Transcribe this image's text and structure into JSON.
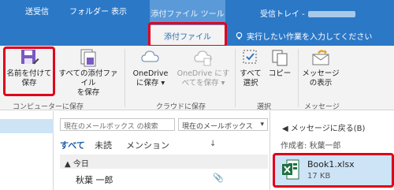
{
  "titlebar": {
    "context_tools": "添付ファイル ツール",
    "window_title": "受信トレイ -"
  },
  "ribbon_tabs": {
    "receive": "送受信",
    "folder": "フォルダー",
    "view": "表示",
    "attachment": "添付ファイル",
    "tell_me": "実行したい作業を入力してください"
  },
  "ribbon": {
    "save_as": "名前を付けて\n保存",
    "save_all": "すべての添付ファイル\nを保存",
    "onedrive_save": "OneDrive\nに保存 ▾",
    "onedrive_all": "OneDrive にす\nべてを保存 ▾",
    "select_all": "すべて\n選択",
    "copy": "コピー",
    "show_message": "メッセージ\nの表示",
    "group_save": "コンピューターに保存",
    "group_cloud": "クラウドに保存",
    "group_select": "選択",
    "group_message": "メッセージ"
  },
  "list": {
    "search_placeholder": "現在のメールボックス の検索",
    "scope": "現在のメールボックス",
    "filter_all": "すべて",
    "filter_unread": "未読",
    "filter_mention": "メンション",
    "sort_arrow": "↓",
    "today": "▲ 今日",
    "sender": "秋葉 一郎"
  },
  "reading": {
    "back": "メッセージに戻る(B)",
    "from_label": "作成者:",
    "from_name": "秋葉一郎",
    "attachment_name": "Book1.xlsx",
    "attachment_size": "17 KB"
  },
  "colors": {
    "titlebar": "#2b78c7",
    "highlight_box": "#e0001b",
    "selection": "#cde4f7",
    "excel_green": "#1e7145"
  }
}
